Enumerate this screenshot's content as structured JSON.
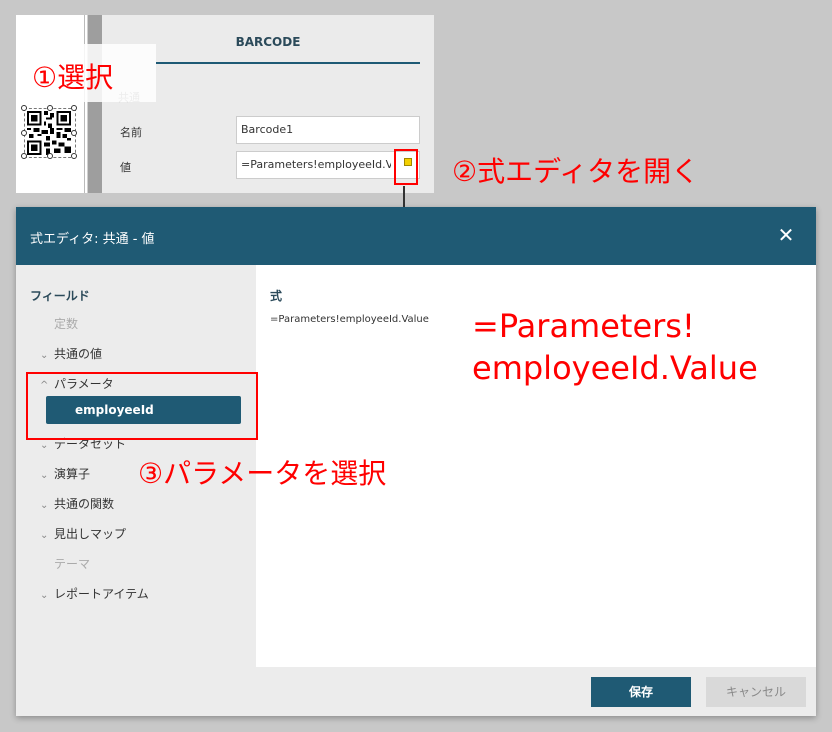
{
  "properties_panel": {
    "tab_label": "BARCODE",
    "section_label": "共通",
    "name_label": "名前",
    "name_value": "Barcode1",
    "value_label": "値",
    "value_value": "=Parameters!employeeId.Va"
  },
  "annotations": {
    "step1": "①選択",
    "step2": "②式エディタを開く",
    "step3": "③パラメータを選択",
    "expr_line1": "=Parameters!",
    "expr_line2": "employeeId.Value"
  },
  "dialog": {
    "title": "式エディタ: 共通 - 値",
    "close_icon": "close-icon",
    "sidebar_heading": "フィールド",
    "tree": [
      {
        "label": "定数",
        "expandable": false,
        "disabled": true
      },
      {
        "label": "共通の値",
        "expandable": true
      },
      {
        "label": "パラメータ",
        "expandable": true,
        "expanded": true
      },
      {
        "label": "データセット",
        "expandable": true
      },
      {
        "label": "演算子",
        "expandable": true
      },
      {
        "label": "共通の関数",
        "expandable": true
      },
      {
        "label": "見出しマップ",
        "expandable": true
      },
      {
        "label": "テーマ",
        "expandable": false,
        "disabled": true
      },
      {
        "label": "レポートアイテム",
        "expandable": true
      }
    ],
    "selected_parameter": "employeeId",
    "expression_heading": "式",
    "expression_text": "=Parameters!employeeId.Value",
    "save_label": "保存",
    "cancel_label": "キャンセル"
  },
  "colors": {
    "accent": "#1f5a74",
    "annotation": "#ff0000",
    "expr_button": "#f3d000"
  }
}
